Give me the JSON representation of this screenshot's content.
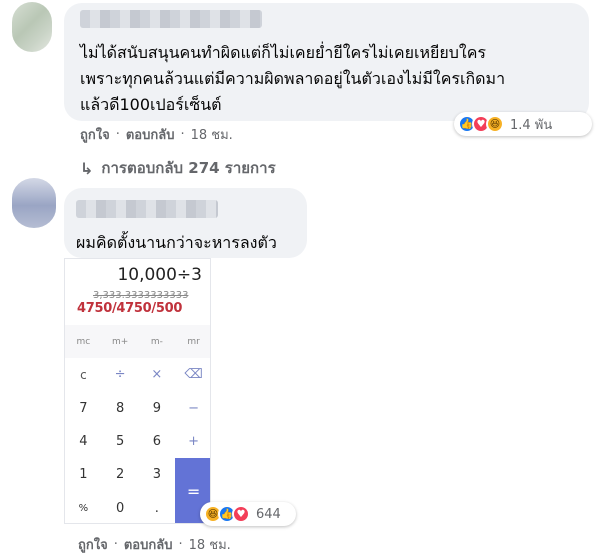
{
  "comment1": {
    "lines": [
      "ไม่ได้สนับสนุนคนทำผิดแต่ก็ไม่เคยย่ำยีใครไม่เคยเหยียบใคร",
      "เพราะทุกคนล้วนแต่มีความผิดพลาดอยู่ในตัวเองไม่มีใครเกิดมา",
      "แล้วดี100เปอร์เซ็นต์"
    ],
    "reactions": {
      "icons": [
        "like-icon",
        "love-icon",
        "haha-icon"
      ],
      "count": "1.4 พัน"
    },
    "actions": {
      "like": "ถูกใจ",
      "reply": "ตอบกลับ",
      "time": "18 ชม."
    },
    "replies_label": "การตอบกลับ 274 รายการ"
  },
  "comment2": {
    "text": "ผมคิดตั้งนานกว่าจะหารลงตัว",
    "reactions": {
      "icons": [
        "haha-icon",
        "like-icon",
        "love-icon"
      ],
      "count": "644"
    },
    "actions": {
      "like": "ถูกใจ",
      "reply": "ตอบกลับ",
      "time": "18 ชม."
    }
  },
  "calculator": {
    "expression": "10,000÷3",
    "old_result": "3,333.3333333333",
    "scribble": "4750/4750/500",
    "keys": [
      "mc",
      "m+",
      "m-",
      "mr",
      "c",
      "÷",
      "×",
      "⌫",
      "7",
      "8",
      "9",
      "−",
      "4",
      "5",
      "6",
      "+",
      "1",
      "2",
      "3",
      "=",
      "%",
      "0",
      "."
    ]
  },
  "colors": {
    "bubble": "#f0f2f5",
    "meta_text": "#65676b",
    "like": "#1877f2",
    "love": "#f33e58",
    "haha": "#f7b125",
    "equals_key": "#6373d6",
    "scribble": "#c0323c"
  }
}
